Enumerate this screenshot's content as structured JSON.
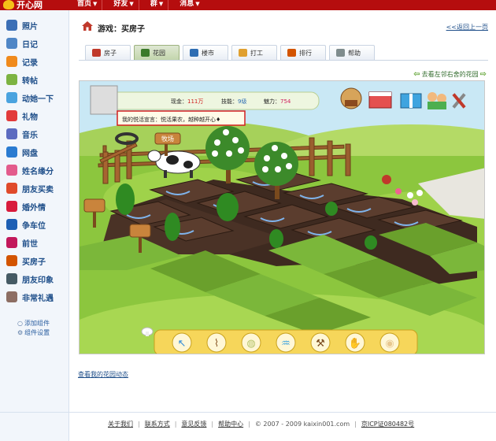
{
  "topbar": {
    "logo_text": "开心网",
    "nav": [
      "首页",
      "好友",
      "群",
      "消息"
    ]
  },
  "sidebar": {
    "items": [
      {
        "label": "照片",
        "icon": "photo-icon",
        "color": "#3b6fb6"
      },
      {
        "label": "日记",
        "icon": "diary-icon",
        "color": "#4f86c6"
      },
      {
        "label": "记录",
        "icon": "record-icon",
        "color": "#f08a1c"
      },
      {
        "label": "转帖",
        "icon": "repost-icon",
        "color": "#7cb342"
      },
      {
        "label": "动她一下",
        "icon": "poke-icon",
        "color": "#4aa3df"
      },
      {
        "label": "礼物",
        "icon": "gift-icon",
        "color": "#e23b3b"
      },
      {
        "label": "音乐",
        "icon": "music-icon",
        "color": "#5c6bc0"
      },
      {
        "label": "网盘",
        "icon": "disk-icon",
        "color": "#2a7bd1"
      },
      {
        "label": "姓名缘分",
        "icon": "name-fate-icon",
        "color": "#e35b8c"
      },
      {
        "label": "朋友买卖",
        "icon": "friend-trade-icon",
        "color": "#e04a2a"
      },
      {
        "label": "婚外情",
        "icon": "heart-icon",
        "color": "#d81b3c"
      },
      {
        "label": "争车位",
        "icon": "parking-icon",
        "color": "#1e5fb4"
      },
      {
        "label": "前世",
        "icon": "past-life-icon",
        "color": "#c2185b"
      },
      {
        "label": "买房子",
        "icon": "house-icon",
        "color": "#d35400"
      },
      {
        "label": "朋友印象",
        "icon": "impression-icon",
        "color": "#455a64"
      },
      {
        "label": "非常礼遇",
        "icon": "courtesy-icon",
        "color": "#8d6e63"
      }
    ],
    "add_component": "添加组件",
    "component_settings": "组件设置"
  },
  "page": {
    "title": "游戏：买房子",
    "back_link": "<<返回上一页"
  },
  "tabs": [
    {
      "label": "房子",
      "icon": "house-tab-icon",
      "active": false
    },
    {
      "label": "花园",
      "icon": "garden-tab-icon",
      "active": true
    },
    {
      "label": "楼市",
      "icon": "market-tab-icon",
      "active": false
    },
    {
      "label": "打工",
      "icon": "work-tab-icon",
      "active": false
    },
    {
      "label": "排行",
      "icon": "rank-tab-icon",
      "active": false
    },
    {
      "label": "帮助",
      "icon": "help-tab-icon",
      "active": false
    }
  ],
  "garden_link": "去看左邻右舍的花园",
  "game": {
    "cash_label": "现金：",
    "cash_value": "111万",
    "skill_label": "技能：",
    "skill_value": "9级",
    "charm_label": "魅力：",
    "charm_value": "754",
    "slogan": "我的悦活宣言：悦活果农，越种越开心♦",
    "farm_sign": "牧场",
    "tools": [
      "pointer-tool-icon",
      "rake-tool-icon",
      "seed-bag-tool-icon",
      "watering-can-tool-icon",
      "shovel-tool-icon",
      "hand-tool-icon",
      "sack-tool-icon"
    ]
  },
  "footer_link": "查看我的花园动态",
  "footer": {
    "links": [
      "关于我们",
      "联系方式",
      "意见反馈",
      "帮助中心"
    ],
    "copyright": "© 2007 - 2009 kaixin001.com",
    "icp": "京ICP证080482号"
  }
}
